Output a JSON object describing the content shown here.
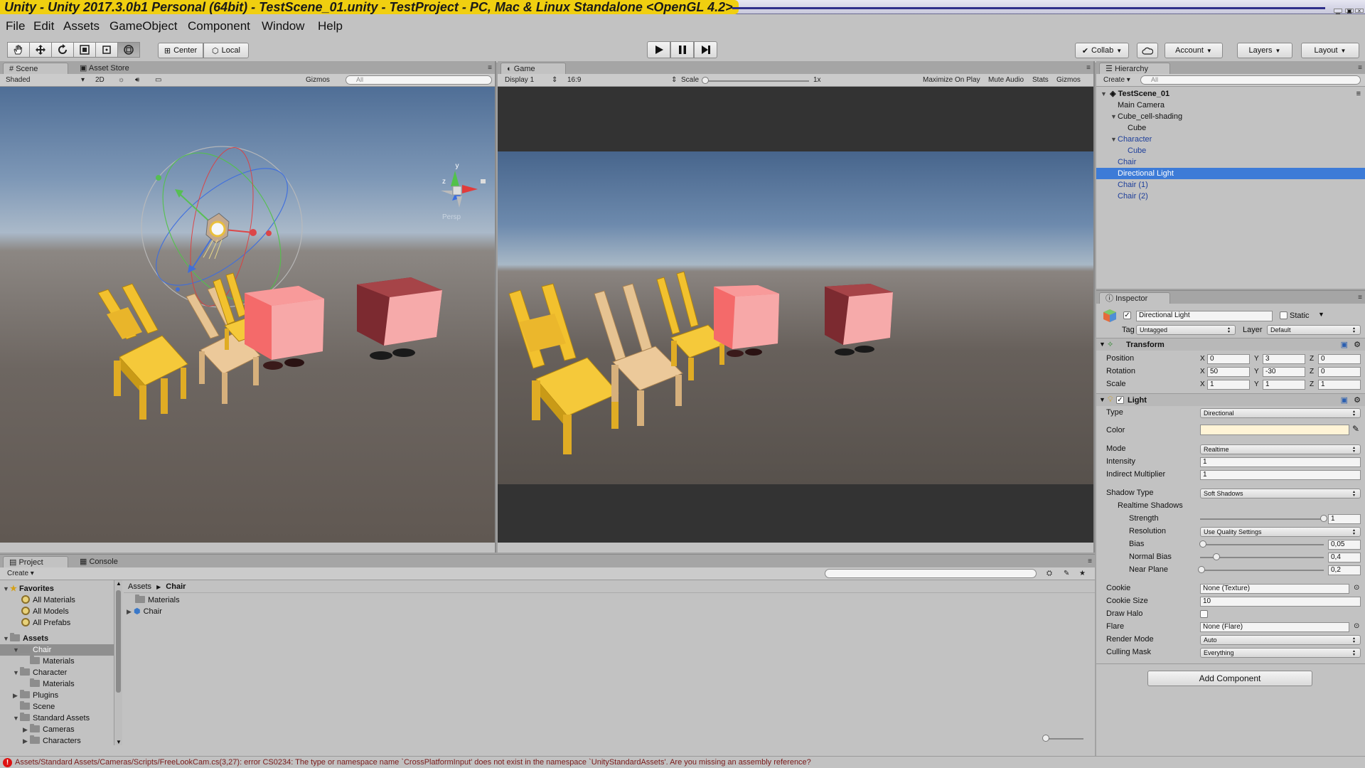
{
  "window": {
    "title": "Unity - Unity 2017.3.0b1 Personal (64bit) - TestScene_01.unity - TestProject - PC, Mac & Linux Standalone <OpenGL 4.2>"
  },
  "menu": [
    "File",
    "Edit",
    "Assets",
    "GameObject",
    "Component",
    "Window",
    "Help"
  ],
  "toolbar": {
    "tools": [
      "hand-tool",
      "move-tool",
      "rotate-tool",
      "scale-tool",
      "rect-tool",
      "transform-tool"
    ],
    "pivot": "Center",
    "space": "Local",
    "collab": "Collab",
    "account": "Account",
    "layers": "Layers",
    "layout": "Layout"
  },
  "scene": {
    "tabs": [
      "Scene",
      "Asset Store"
    ],
    "shading": "Shaded",
    "mode_2d": "2D",
    "gizmos": "Gizmos",
    "search_placeholder": "All",
    "persp": "Persp",
    "gizmo_axes": {
      "y": "y",
      "x": "x",
      "z": "z"
    }
  },
  "game": {
    "tab": "Game",
    "display": "Display 1",
    "aspect": "16:9",
    "scale_label": "Scale",
    "scale_value": "1x",
    "scale_slider": 0,
    "maximize": "Maximize On Play",
    "mute": "Mute Audio",
    "stats": "Stats",
    "gizmos": "Gizmos"
  },
  "hierarchy": {
    "tab": "Hierarchy",
    "create": "Create",
    "search_placeholder": "All",
    "scene_name": "TestScene_01",
    "items": [
      {
        "label": "Main Camera",
        "depth": 1,
        "expanded": null,
        "selected": false,
        "prefab": false
      },
      {
        "label": "Cube_cell-shading",
        "depth": 1,
        "expanded": true,
        "selected": false,
        "prefab": false
      },
      {
        "label": "Cube",
        "depth": 2,
        "expanded": null,
        "selected": false,
        "prefab": false
      },
      {
        "label": "Character",
        "depth": 1,
        "expanded": true,
        "selected": false,
        "prefab": true
      },
      {
        "label": "Cube",
        "depth": 2,
        "expanded": null,
        "selected": false,
        "prefab": true
      },
      {
        "label": "Chair",
        "depth": 1,
        "expanded": null,
        "selected": false,
        "prefab": true
      },
      {
        "label": "Directional Light",
        "depth": 1,
        "expanded": null,
        "selected": true,
        "prefab": false
      },
      {
        "label": "Chair (1)",
        "depth": 1,
        "expanded": null,
        "selected": false,
        "prefab": true
      },
      {
        "label": "Chair (2)",
        "depth": 1,
        "expanded": null,
        "selected": false,
        "prefab": true
      }
    ]
  },
  "inspector": {
    "tab": "Inspector",
    "object_name": "Directional Light",
    "static_label": "Static",
    "tag_label": "Tag",
    "tag_value": "Untagged",
    "layer_label": "Layer",
    "layer_value": "Default",
    "transform": {
      "title": "Transform",
      "position_label": "Position",
      "rotation_label": "Rotation",
      "scale_label": "Scale",
      "position": {
        "x": "0",
        "y": "3",
        "z": "0"
      },
      "rotation": {
        "x": "50",
        "y": "-30",
        "z": "0"
      },
      "scale": {
        "x": "1",
        "y": "1",
        "z": "1"
      }
    },
    "light": {
      "title": "Light",
      "type_label": "Type",
      "type": "Directional",
      "color_label": "Color",
      "color": "#fff4d6",
      "mode_label": "Mode",
      "mode": "Realtime",
      "intensity_label": "Intensity",
      "intensity": "1",
      "indirect_label": "Indirect Multiplier",
      "indirect": "1",
      "shadow_type_label": "Shadow Type",
      "shadow_type": "Soft Shadows",
      "realtime_shadows_label": "Realtime Shadows",
      "strength_label": "Strength",
      "strength": "1",
      "strength_level": 1.0,
      "resolution_label": "Resolution",
      "resolution": "Use Quality Settings",
      "bias_label": "Bias",
      "bias": "0,05",
      "bias_level": 0.025,
      "normal_bias_label": "Normal Bias",
      "normal_bias": "0,4",
      "normal_bias_level": 0.133,
      "near_plane_label": "Near Plane",
      "near_plane": "0,2",
      "near_plane_level": 0.01,
      "cookie_label": "Cookie",
      "cookie": "None (Texture)",
      "cookie_size_label": "Cookie Size",
      "cookie_size": "10",
      "draw_halo_label": "Draw Halo",
      "flare_label": "Flare",
      "flare": "None (Flare)",
      "render_mode_label": "Render Mode",
      "render_mode": "Auto",
      "culling_mask_label": "Culling Mask",
      "culling_mask": "Everything"
    },
    "add_component": "Add Component"
  },
  "project": {
    "tabs": [
      "Project",
      "Console"
    ],
    "create": "Create",
    "favorites_label": "Favorites",
    "favorites": [
      "All Materials",
      "All Models",
      "All Prefabs"
    ],
    "assets_label": "Assets",
    "tree": [
      {
        "label": "Chair",
        "depth": 1,
        "expanded": true,
        "selected": true
      },
      {
        "label": "Materials",
        "depth": 2,
        "expanded": null,
        "selected": false
      },
      {
        "label": "Character",
        "depth": 1,
        "expanded": true,
        "selected": false
      },
      {
        "label": "Materials",
        "depth": 2,
        "expanded": null,
        "selected": false
      },
      {
        "label": "Plugins",
        "depth": 1,
        "expanded": false,
        "selected": false
      },
      {
        "label": "Scene",
        "depth": 1,
        "expanded": null,
        "selected": false
      },
      {
        "label": "Standard Assets",
        "depth": 1,
        "expanded": true,
        "selected": false
      },
      {
        "label": "Cameras",
        "depth": 2,
        "expanded": false,
        "selected": false
      },
      {
        "label": "Characters",
        "depth": 2,
        "expanded": false,
        "selected": false
      }
    ],
    "breadcrumb": [
      "Assets",
      "Chair"
    ],
    "contents": [
      {
        "label": "Materials",
        "kind": "folder"
      },
      {
        "label": "Chair",
        "kind": "prefab"
      }
    ]
  },
  "status": {
    "error": "Assets/Standard Assets/Cameras/Scripts/FreeLookCam.cs(3,27): error CS0234: The type or namespace name `CrossPlatformInput' does not exist in the namespace `UnityStandardAssets'. Are you missing an assembly reference?"
  },
  "colors": {
    "selection": "#3d7bd7",
    "chair_yellow": "#f2c12e",
    "chair_tan": "#e7c596",
    "cube_pink": "#f46a6a",
    "cube_dark": "#7c2a30",
    "title_yellow": "#f0cf10"
  }
}
